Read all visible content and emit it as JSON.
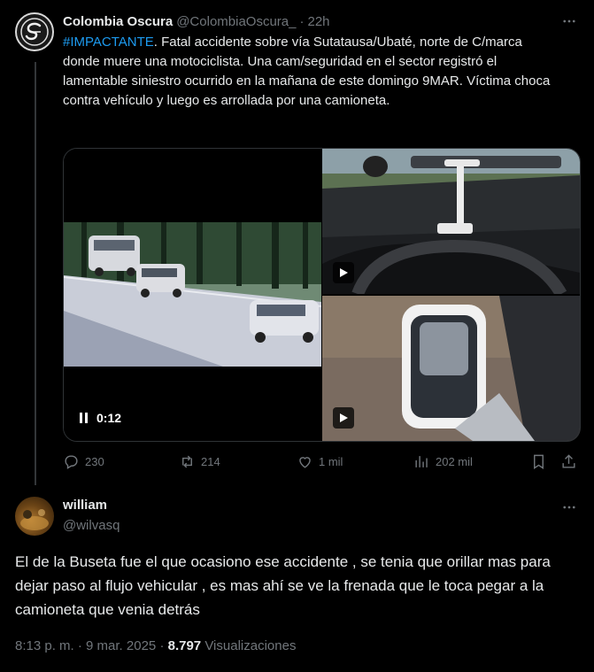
{
  "tweet": {
    "author_name": "Colombia Oscura",
    "author_handle": "@ColombiaOscura_",
    "separator": "·",
    "time": "22h",
    "hashtag": "#IMPACTANTE",
    "text": ". Fatal accidente sobre vía Sutatausa/Ubaté, norte de C/marca donde muere una motociclista. Una cam/seguridad en el sector registró el lamentable siniestro ocurrido en la mañana de este domingo 9MAR. Víctima choca contra vehículo y luego es arrollada por una camioneta.",
    "video_time": "0:12",
    "actions": {
      "replies": "230",
      "reposts": "214",
      "likes": "1 mil",
      "views": "202 mil"
    }
  },
  "reply": {
    "author_name": "william",
    "author_handle": "@wilvasq",
    "text": "El de la Buseta fue el que ocasiono ese accidente , se tenia que orillar mas para dejar paso al flujo vehicular , es mas ahí se ve la frenada que le toca pegar a la camioneta que venia detrás",
    "timestamp": "8:13 p. m. · 9 mar. 2025",
    "separator": "·",
    "views_count": "8.797",
    "views_label": "Visualizaciones"
  },
  "colors": {
    "background": "#000000",
    "text": "#e7e9ea",
    "muted": "#71767b",
    "accent": "#1d9bf0",
    "border": "#2f3336"
  },
  "icons": [
    "more-icon",
    "reply-icon",
    "repost-icon",
    "like-icon",
    "views-icon",
    "bookmark-icon",
    "pause-icon",
    "play-icon"
  ]
}
